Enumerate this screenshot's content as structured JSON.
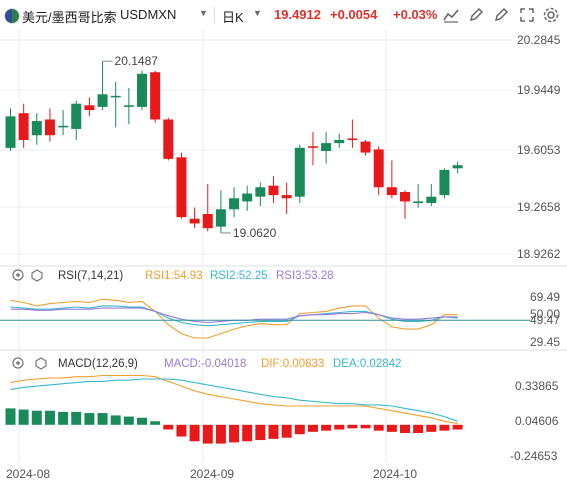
{
  "header": {
    "pair_name": "美元/墨西哥比索",
    "symbol": "USDMXN",
    "period": "日K",
    "last": "19.4912",
    "change": "+0.0054",
    "change_pct": "+0.03%",
    "tools": [
      "line-chart-icon",
      "draw-icon",
      "fullscreen-icon",
      "settings-icon"
    ]
  },
  "chart_data": [
    {
      "type": "candlestick",
      "price_ticks": [
        "20.2845",
        "19.9449",
        "19.6053",
        "19.2658",
        "18.9262"
      ],
      "ylim": [
        18.9262,
        20.2845
      ],
      "high_label": "20.1487",
      "low_label": "19.0620",
      "x_dates": [
        "2024-08",
        "2024-09",
        "2024-10"
      ],
      "candles": [
        {
          "o": 19.6,
          "h": 19.85,
          "l": 19.58,
          "c": 19.8
        },
        {
          "o": 19.82,
          "h": 19.88,
          "l": 19.6,
          "c": 19.65
        },
        {
          "o": 19.68,
          "h": 19.82,
          "l": 19.62,
          "c": 19.77
        },
        {
          "o": 19.78,
          "h": 19.85,
          "l": 19.64,
          "c": 19.68
        },
        {
          "o": 19.73,
          "h": 19.84,
          "l": 19.68,
          "c": 19.74
        },
        {
          "o": 19.72,
          "h": 19.9,
          "l": 19.65,
          "c": 19.88
        },
        {
          "o": 19.87,
          "h": 19.92,
          "l": 19.8,
          "c": 19.84
        },
        {
          "o": 19.86,
          "h": 20.15,
          "l": 19.84,
          "c": 19.94
        },
        {
          "o": 19.93,
          "h": 20.02,
          "l": 19.73,
          "c": 19.93
        },
        {
          "o": 19.86,
          "h": 19.98,
          "l": 19.75,
          "c": 19.87
        },
        {
          "o": 19.86,
          "h": 20.09,
          "l": 19.84,
          "c": 20.07
        },
        {
          "o": 20.08,
          "h": 20.09,
          "l": 19.76,
          "c": 19.78
        },
        {
          "o": 19.78,
          "h": 19.79,
          "l": 19.52,
          "c": 19.53
        },
        {
          "o": 19.54,
          "h": 19.57,
          "l": 19.15,
          "c": 19.16
        },
        {
          "o": 19.15,
          "h": 19.22,
          "l": 19.09,
          "c": 19.12
        },
        {
          "o": 19.18,
          "h": 19.37,
          "l": 19.07,
          "c": 19.09
        },
        {
          "o": 19.1,
          "h": 19.33,
          "l": 19.06,
          "c": 19.21
        },
        {
          "o": 19.21,
          "h": 19.35,
          "l": 19.16,
          "c": 19.28
        },
        {
          "o": 19.26,
          "h": 19.36,
          "l": 19.2,
          "c": 19.31
        },
        {
          "o": 19.29,
          "h": 19.38,
          "l": 19.23,
          "c": 19.35
        },
        {
          "o": 19.36,
          "h": 19.42,
          "l": 19.25,
          "c": 19.3
        },
        {
          "o": 19.3,
          "h": 19.38,
          "l": 19.18,
          "c": 19.28
        },
        {
          "o": 19.29,
          "h": 19.62,
          "l": 19.25,
          "c": 19.6
        },
        {
          "o": 19.61,
          "h": 19.7,
          "l": 19.49,
          "c": 19.6
        },
        {
          "o": 19.58,
          "h": 19.7,
          "l": 19.5,
          "c": 19.63
        },
        {
          "o": 19.63,
          "h": 19.69,
          "l": 19.6,
          "c": 19.65
        },
        {
          "o": 19.66,
          "h": 19.78,
          "l": 19.6,
          "c": 19.65
        },
        {
          "o": 19.64,
          "h": 19.65,
          "l": 19.55,
          "c": 19.57
        },
        {
          "o": 19.59,
          "h": 19.61,
          "l": 19.3,
          "c": 19.35
        },
        {
          "o": 19.35,
          "h": 19.52,
          "l": 19.28,
          "c": 19.3
        },
        {
          "o": 19.32,
          "h": 19.33,
          "l": 19.15,
          "c": 19.26
        },
        {
          "o": 19.25,
          "h": 19.37,
          "l": 19.22,
          "c": 19.26
        },
        {
          "o": 19.25,
          "h": 19.37,
          "l": 19.23,
          "c": 19.29
        },
        {
          "o": 19.3,
          "h": 19.47,
          "l": 19.28,
          "c": 19.46
        },
        {
          "o": 19.47,
          "h": 19.51,
          "l": 19.44,
          "c": 19.49
        }
      ]
    },
    {
      "type": "line",
      "label": "RSI(7,14,21)",
      "values_text": [
        "RSI1:54.93",
        "RSI2:52.25",
        "RSI3:53.28"
      ],
      "ticks": [
        "69.49",
        "50.00",
        "49.47",
        "29.45"
      ],
      "ylim": [
        25,
        80
      ],
      "series": [
        {
          "name": "RSI1",
          "color": "#f0a030",
          "values": [
            68,
            66,
            63,
            65,
            66,
            67,
            66,
            69,
            68,
            66,
            67,
            58,
            46,
            38,
            34,
            34,
            38,
            42,
            45,
            47,
            46,
            46,
            56,
            57,
            58,
            61,
            63,
            63,
            52,
            44,
            42,
            42,
            46,
            55,
            55
          ]
        },
        {
          "name": "RSI2",
          "color": "#3ab7d1",
          "values": [
            62,
            61,
            60,
            60,
            61,
            62,
            61,
            63,
            63,
            62,
            62,
            58,
            52,
            48,
            46,
            45,
            46,
            47,
            48,
            49,
            49,
            49,
            54,
            55,
            56,
            57,
            58,
            58,
            55,
            51,
            49,
            49,
            50,
            53,
            52
          ]
        },
        {
          "name": "RSI3",
          "color": "#9a7ad6",
          "values": [
            60,
            60,
            59,
            59,
            60,
            60,
            60,
            61,
            61,
            61,
            61,
            58,
            54,
            51,
            49,
            48,
            49,
            50,
            50,
            51,
            51,
            51,
            54,
            55,
            55,
            56,
            56,
            57,
            55,
            52,
            51,
            51,
            52,
            53,
            53
          ]
        }
      ]
    },
    {
      "type": "bar+line",
      "label": "MACD(12,26,9)",
      "values_text": [
        "MACD:-0.04018",
        "DIF:0.00833",
        "DEA:0.02842"
      ],
      "ticks": [
        "0.33865",
        "0.04606",
        "-0.24653"
      ],
      "ylim": [
        -0.3,
        0.45
      ],
      "series": [
        {
          "name": "MACD",
          "type": "bar",
          "values": [
            0.14,
            0.13,
            0.12,
            0.12,
            0.11,
            0.11,
            0.1,
            0.1,
            0.08,
            0.07,
            0.06,
            0.03,
            -0.04,
            -0.1,
            -0.14,
            -0.16,
            -0.16,
            -0.15,
            -0.14,
            -0.13,
            -0.12,
            -0.11,
            -0.08,
            -0.06,
            -0.05,
            -0.04,
            -0.03,
            -0.03,
            -0.05,
            -0.06,
            -0.07,
            -0.07,
            -0.06,
            -0.05,
            -0.04
          ]
        },
        {
          "name": "DIF",
          "color": "#f0a030",
          "values": [
            0.36,
            0.38,
            0.39,
            0.4,
            0.4,
            0.41,
            0.41,
            0.42,
            0.42,
            0.42,
            0.42,
            0.41,
            0.37,
            0.33,
            0.29,
            0.26,
            0.24,
            0.22,
            0.2,
            0.18,
            0.17,
            0.16,
            0.16,
            0.16,
            0.16,
            0.16,
            0.16,
            0.16,
            0.14,
            0.12,
            0.1,
            0.08,
            0.06,
            0.03,
            0.01
          ]
        },
        {
          "name": "DEA",
          "color": "#3ab7d1",
          "values": [
            0.3,
            0.32,
            0.33,
            0.34,
            0.35,
            0.36,
            0.37,
            0.37,
            0.38,
            0.38,
            0.39,
            0.39,
            0.39,
            0.38,
            0.36,
            0.34,
            0.32,
            0.3,
            0.28,
            0.26,
            0.24,
            0.23,
            0.21,
            0.2,
            0.19,
            0.18,
            0.18,
            0.17,
            0.17,
            0.16,
            0.14,
            0.12,
            0.1,
            0.07,
            0.03
          ]
        }
      ]
    }
  ],
  "colors": {
    "up": "#e8191b",
    "down": "#1a8a5a",
    "grid": "#e9ecef",
    "axis_text": "#555555"
  }
}
